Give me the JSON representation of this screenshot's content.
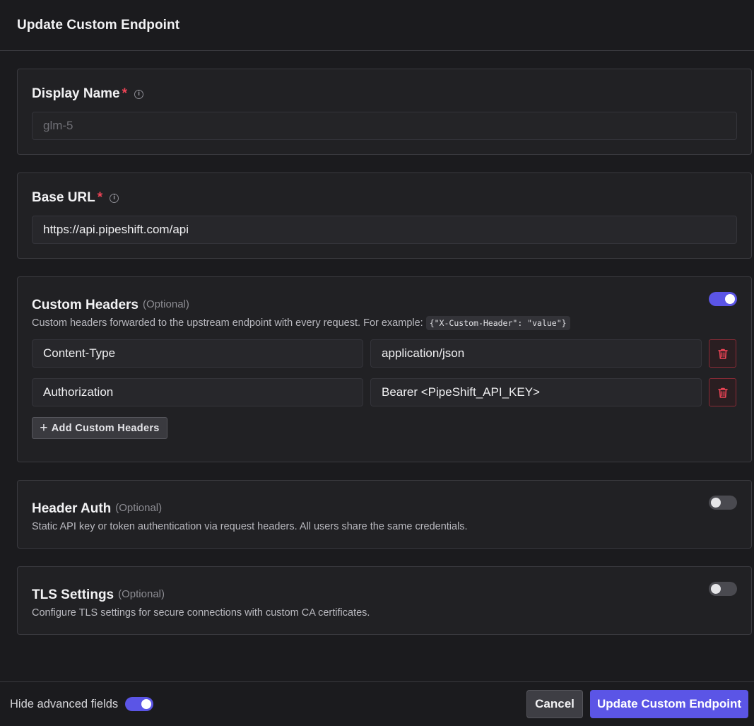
{
  "header": {
    "title": "Update Custom Endpoint"
  },
  "display_name": {
    "label": "Display Name",
    "required_mark": "*",
    "value": "glm-5",
    "info_icon": "info-icon"
  },
  "base_url": {
    "label": "Base URL",
    "required_mark": "*",
    "value": "https://api.pipeshift.com/api",
    "info_icon": "info-icon"
  },
  "custom_headers": {
    "label": "Custom Headers",
    "optional": "(Optional)",
    "enabled": true,
    "description": "Custom headers forwarded to the upstream endpoint with every request. For example:",
    "example_code": "{\"X-Custom-Header\": \"value\"}",
    "rows": [
      {
        "key": "Content-Type",
        "value": "application/json"
      },
      {
        "key": "Authorization",
        "value": "Bearer <PipeShift_API_KEY>"
      }
    ],
    "add_label": "Add Custom Headers"
  },
  "header_auth": {
    "label": "Header Auth",
    "optional": "(Optional)",
    "enabled": false,
    "description": "Static API key or token authentication via request headers. All users share the same credentials."
  },
  "tls": {
    "label": "TLS Settings",
    "optional": "(Optional)",
    "enabled": false,
    "description": "Configure TLS settings for secure connections with custom CA certificates."
  },
  "footer": {
    "hide_advanced_label": "Hide advanced fields",
    "hide_advanced_enabled": true,
    "cancel_label": "Cancel",
    "submit_label": "Update Custom Endpoint"
  },
  "colors": {
    "accent": "#5b55e6",
    "danger": "#ef4456",
    "background": "#1b1b1e",
    "card": "#212124"
  }
}
